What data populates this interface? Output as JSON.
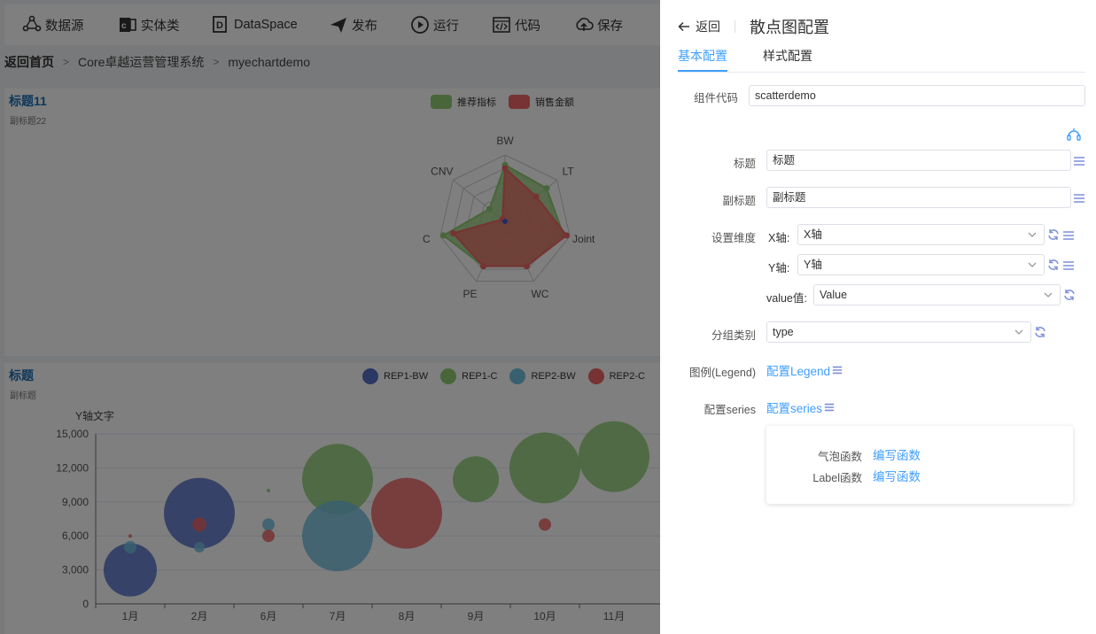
{
  "toolbar": {
    "items": [
      {
        "label": "数据源",
        "icon": "datasource-icon"
      },
      {
        "label": "实体类",
        "icon": "entity-icon"
      },
      {
        "label": "DataSpace",
        "icon": "dataspace-icon"
      },
      {
        "label": "发布",
        "icon": "publish-icon"
      },
      {
        "label": "运行",
        "icon": "run-icon"
      },
      {
        "label": "代码",
        "icon": "code-icon"
      },
      {
        "label": "保存",
        "icon": "save-icon"
      }
    ]
  },
  "breadcrumb": {
    "home": "返回首页",
    "items": [
      "Core卓越运营管理系统",
      "myechartdemo"
    ]
  },
  "radar_panel": {
    "title": "标题11",
    "subtitle": "副标题22",
    "legend": [
      {
        "name": "推荐指标",
        "color": "#91cc75"
      },
      {
        "name": "销售金额",
        "color": "#ee6666"
      }
    ],
    "chart_data": {
      "type": "radar",
      "indicators": [
        "BW",
        "LT",
        "Joint",
        "WC",
        "PE",
        "C",
        "CNV"
      ],
      "series": [
        {
          "name": "推荐指标",
          "color": "#91cc75",
          "values": [
            0.85,
            0.8,
            0.9,
            0.75,
            0.75,
            0.95,
            0.3
          ]
        },
        {
          "name": "销售金额",
          "color": "#ee6666",
          "values": [
            0.8,
            0.6,
            0.95,
            0.75,
            0.75,
            0.8,
            0.05
          ]
        }
      ]
    }
  },
  "bubble_panel": {
    "title": "标题",
    "subtitle": "副标题",
    "legend": [
      {
        "name": "REP1-BW",
        "color": "#5470c6"
      },
      {
        "name": "REP1-C",
        "color": "#91cc75"
      },
      {
        "name": "REP2-BW",
        "color": "#73c0de"
      },
      {
        "name": "REP2-C",
        "color": "#ee6666"
      }
    ],
    "chart_data": {
      "type": "scatter",
      "ylabel": "Y轴文字",
      "categories": [
        "1月",
        "2月",
        "6月",
        "7月",
        "8月",
        "9月",
        "10月",
        "11月"
      ],
      "yticks": [
        "0",
        "3,000",
        "6,000",
        "9,000",
        "12,000",
        "15,000"
      ],
      "ylim": [
        0,
        15000
      ],
      "series": [
        {
          "name": "REP1-BW",
          "color": "#5470c6",
          "points": [
            {
              "x": "1月",
              "y": 3000,
              "s": 30
            },
            {
              "x": "2月",
              "y": 8000,
              "s": 40
            }
          ]
        },
        {
          "name": "REP1-C",
          "color": "#91cc75",
          "points": [
            {
              "x": "6月",
              "y": 10000,
              "s": 2
            },
            {
              "x": "7月",
              "y": 11000,
              "s": 40
            },
            {
              "x": "9月",
              "y": 11000,
              "s": 26
            },
            {
              "x": "10月",
              "y": 12000,
              "s": 40
            },
            {
              "x": "11月",
              "y": 13000,
              "s": 40
            }
          ]
        },
        {
          "name": "REP2-BW",
          "color": "#73c0de",
          "points": [
            {
              "x": "1月",
              "y": 5000,
              "s": 7
            },
            {
              "x": "2月",
              "y": 5000,
              "s": 6
            },
            {
              "x": "6月",
              "y": 7000,
              "s": 7
            },
            {
              "x": "7月",
              "y": 6000,
              "s": 40
            }
          ]
        },
        {
          "name": "REP2-C",
          "color": "#ee6666",
          "points": [
            {
              "x": "1月",
              "y": 6000,
              "s": 2
            },
            {
              "x": "2月",
              "y": 7000,
              "s": 8
            },
            {
              "x": "6月",
              "y": 6000,
              "s": 7
            },
            {
              "x": "8月",
              "y": 8000,
              "s": 40
            },
            {
              "x": "10月",
              "y": 7000,
              "s": 7
            }
          ]
        }
      ]
    }
  },
  "drawer": {
    "back_label": "返回",
    "title": "散点图配置",
    "tabs": [
      "基本配置",
      "样式配置"
    ],
    "component_code": {
      "label": "组件代码",
      "value": "scatterdemo"
    },
    "title_field": {
      "label": "标题",
      "value": "标题"
    },
    "subtitle_field": {
      "label": "副标题",
      "value": "副标题"
    },
    "dimension": {
      "label": "设置维度",
      "x_label": "X轴:",
      "x_value": "X轴",
      "y_label": "Y轴:",
      "y_value": "Y轴",
      "v_label": "value值:",
      "v_value": "Value"
    },
    "group": {
      "label": "分组类别",
      "value": "type"
    },
    "legend": {
      "label": "图例(Legend)",
      "link": "配置Legend"
    },
    "series": {
      "label": "配置series",
      "link": "配置series"
    },
    "functions": {
      "bubble_label": "气泡函数",
      "bubble_link": "编写函数",
      "label_label": "Label函数",
      "label_link": "编写函数"
    }
  }
}
